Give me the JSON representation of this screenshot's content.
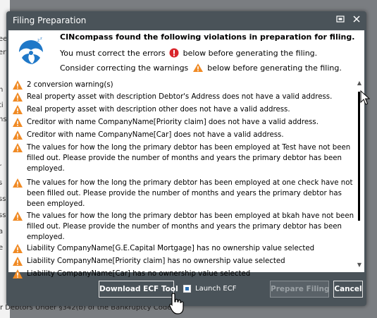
{
  "background": {
    "left_fragments": [
      "ee",
      "ert",
      "i",
      "h",
      "ti",
      "ns",
      "l",
      "l",
      "r",
      "s",
      "ss",
      "ss",
      "a",
      "e"
    ],
    "bottom_text": "r Debtors Under §342(b) of the Bankruptcy Code"
  },
  "dialog": {
    "title": "Filing Preparation",
    "header": {
      "title": "CINcompass found the following violations in preparation for filing.",
      "error_line_before": "You must correct the errors",
      "error_line_after": "below before generating the filing.",
      "warning_line_before": "Consider correcting the warnings",
      "warning_line_after": "below before generating the filing."
    },
    "items": [
      "2 conversion warning(s)",
      "Real property asset with description Debtor's Address does not have a valid address.",
      "Real property asset with description other does not have a valid address.",
      "Creditor with name CompanyName[Priority claim] does not have a valid address.",
      "Creditor with name CompanyName[Car] does not have a valid address.",
      "The values for how the long the primary debtor has been employed at Test have not been filled out. Please provide the number of months and years the primary debtor has been employed.",
      "The values for how the long the primary debtor has been employed at one check have not been filled out. Please provide the number of months and years the primary debtor has been employed.",
      "The values for how the long the primary debtor has been employed at bkah have not been filled out. Please provide the number of months and years the primary debtor has been employed.",
      "Liability CompanyName[G.E.Capital Mortgage] has no ownership value selected",
      "Liability CompanyName[Priority claim] has no ownership value selected",
      "Liability CompanyName[Car] has no ownership value selected"
    ],
    "footer": {
      "download_label": "Download ECF Tool",
      "launch_label": "Launch ECF",
      "launch_checked": true,
      "prepare_label": "Prepare Filing",
      "cancel_label": "Cancel"
    }
  },
  "colors": {
    "dialog_bg": "#4a5359",
    "warning": "#f08a24",
    "error": "#d9262c",
    "logo": "#1f78c8"
  }
}
